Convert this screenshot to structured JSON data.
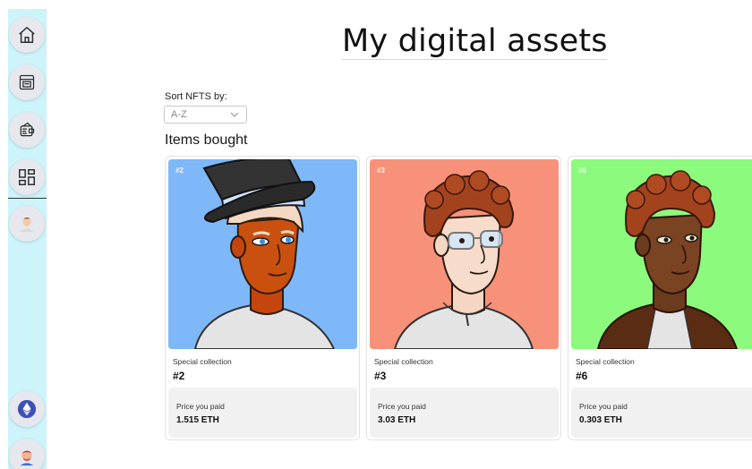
{
  "page": {
    "title": "My digital assets"
  },
  "sidebar": {
    "items": [
      {
        "name": "home-icon"
      },
      {
        "name": "nft-store-icon"
      },
      {
        "name": "wallet-icon"
      },
      {
        "name": "dashboard-icon"
      },
      {
        "name": "profile-avatar-icon"
      }
    ],
    "bottom": [
      {
        "name": "ethereum-icon"
      },
      {
        "name": "user-avatar-icon"
      }
    ]
  },
  "sort": {
    "label": "Sort NFTS by:",
    "selected": "A-Z"
  },
  "section": {
    "title": "Items bought"
  },
  "cards": [
    {
      "tag": "#2",
      "collection": "Special collection",
      "name": "#2",
      "price_label": "Price you paid",
      "price": "1.515 ETH",
      "bg": "#7fb8f8"
    },
    {
      "tag": "#3",
      "collection": "Special collection",
      "name": "#3",
      "price_label": "Price you paid",
      "price": "3.03 ETH",
      "bg": "#f8917a"
    },
    {
      "tag": "#6",
      "collection": "Special collection",
      "name": "#6",
      "price_label": "Price you paid",
      "price": "0.303 ETH",
      "bg": "#8cfa7c"
    }
  ]
}
